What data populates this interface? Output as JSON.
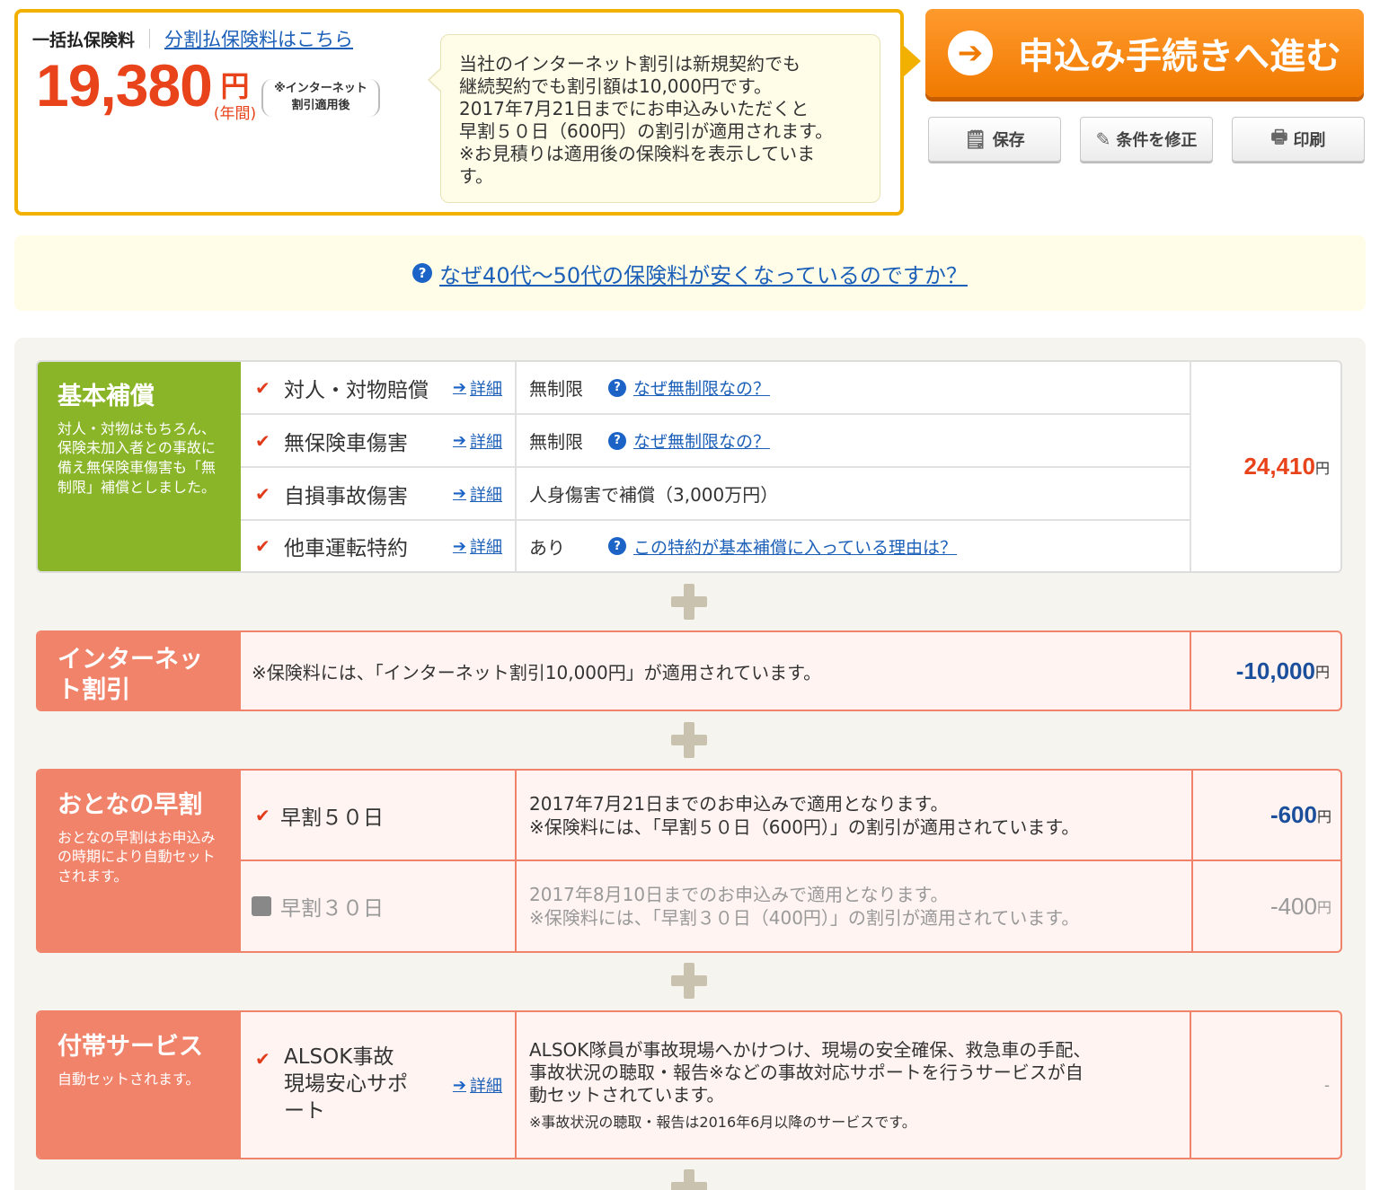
{
  "premium": {
    "active_tab": "一括払保険料",
    "installment_link": "分割払保険料はこちら",
    "amount": "19,380",
    "unit": "円",
    "period": "(年間)",
    "note_line1": "※インターネット",
    "note_line2": "割引適用後"
  },
  "bubble": {
    "line1": "当社のインターネット割引は新規契約でも",
    "line2": "継続契約でも割引額は10,000円です。",
    "line3": "2017年7月21日までにお申込みいただくと",
    "line4": "早割５０日（600円）の割引が適用されます。",
    "line5": "※お見積りは適用後の保険料を表示していま",
    "line6": "す。"
  },
  "actions": {
    "apply_label": "申込み手続きへ進む",
    "apply_icon": "arrow-right-circle",
    "save_label": "保存",
    "edit_label": "条件を修正",
    "print_label": "印刷"
  },
  "faq": {
    "icon": "?",
    "link": "なぜ40代～50代の保険料が安くなっているのですか？"
  },
  "basic": {
    "title": "基本補償",
    "desc": "対人・対物はもちろん、保険未加入者との事故に備え無保険車傷害も「無制限」補償としました。",
    "detail_label": "詳細",
    "amount": "24,410",
    "amount_unit": "円",
    "amount_color": "#e8431a",
    "items": [
      {
        "name": "対人・対物賠償",
        "value": "無制限",
        "link": "なぜ無制限なの？"
      },
      {
        "name": "無保険車傷害",
        "value": "無制限",
        "link": "なぜ無制限なの？"
      },
      {
        "name": "自損事故傷害",
        "value": "人身傷害で補償（3,000万円）",
        "link": ""
      },
      {
        "name": "他車運転特約",
        "value": "あり",
        "link": "この特約が基本補償に入っている理由は？"
      }
    ]
  },
  "internet": {
    "title": "インターネット割引",
    "text": "※保険料には、「インターネット割引10,000円」が適用されています。",
    "amount": "-10,000",
    "amount_unit": "円",
    "amount_color": "#1b4f9c"
  },
  "early": {
    "title": "おとなの早割",
    "desc": "おとなの早割はお申込みの時期により自動セットされます。",
    "items": [
      {
        "name": "早割５０日",
        "line1": "2017年7月21日までのお申込みで適用となります。",
        "line2": "※保険料には、「早割５０日（600円）」の割引が適用されています。",
        "amount": "-600",
        "unit": "円"
      },
      {
        "name": "早割３０日",
        "line1": "2017年8月10日までのお申込みで適用となります。",
        "line2": "※保険料には、「早割３０日（400円）」の割引が適用されています。",
        "amount": "-400",
        "unit": "円"
      }
    ]
  },
  "service": {
    "title": "付帯サービス",
    "desc": "自動セットされます。",
    "name_line1": "ALSOK事故",
    "name_line2": "現場安心サポ",
    "name_line3": "ート",
    "detail_label": "詳細",
    "text_line1": "ALSOK隊員が事故現場へかけつけ、現場の安全確保、救急車の手配、",
    "text_line2": "事故状況の聴取・報告※などの事故対応サポートを行うサービスが自",
    "text_line3": "動セットされています。",
    "note": "※事故状況の聴取・報告は2016年6月以降のサービスです。",
    "amount": "-"
  },
  "colors": {
    "accent_orange": "#f17a00",
    "border_yellow": "#f2b100",
    "green": "#8ab528",
    "coral": "#f0836a",
    "price_red": "#e8431a",
    "link_blue": "#1b5fb8"
  }
}
